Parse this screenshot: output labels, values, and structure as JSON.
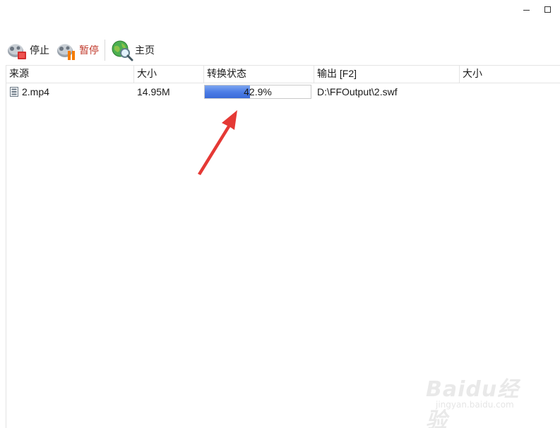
{
  "toolbar": {
    "stop_label": "停止",
    "pause_label": "暂停",
    "home_label": "主页"
  },
  "columns": [
    "来源",
    "大小",
    "转换状态",
    "输出 [F2]",
    "大小"
  ],
  "rows": [
    {
      "source": "2.mp4",
      "size": "14.95M",
      "progress_text": "42.9%",
      "progress_fraction": 0.429,
      "output": "D:\\FFOutput\\2.swf",
      "output_size": ""
    }
  ],
  "colors": {
    "progress_fill": "#4d7ee6",
    "accent_label": "#c0392b",
    "annotation_arrow": "#e53935"
  },
  "watermark": {
    "brand": "Baidu经验",
    "site": "jingyan.baidu.com"
  }
}
